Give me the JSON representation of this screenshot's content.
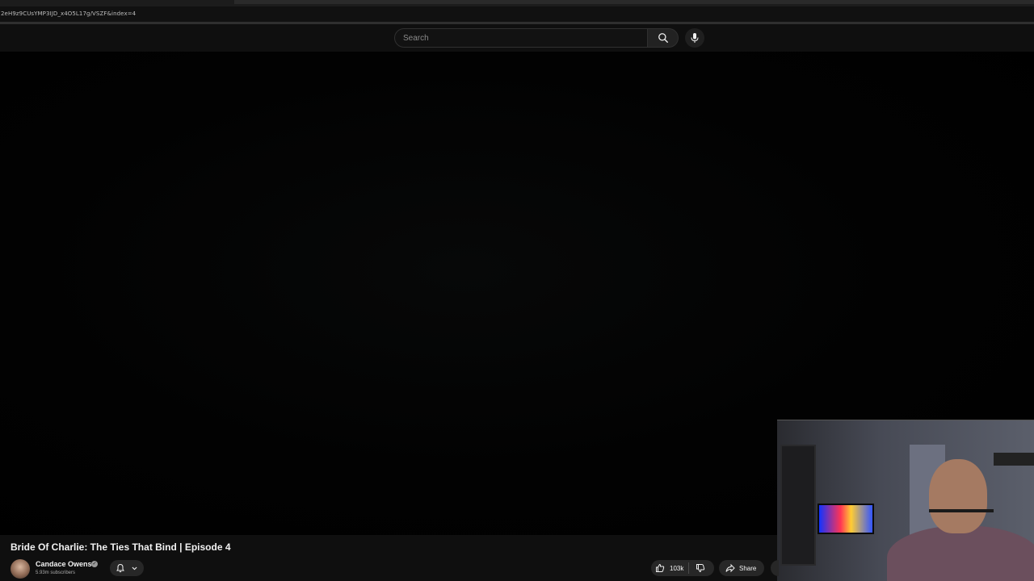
{
  "browser": {
    "url": "2eH9z9CUsYMP3IJD_x4O5L17g/VSZF&index=4"
  },
  "masthead": {
    "search_placeholder": "Search",
    "search_icon": "search-icon",
    "mic_icon": "microphone-icon"
  },
  "video": {
    "title": "Bride Of Charlie: The Ties That Bind | Episode 4",
    "channel": {
      "name": "Candace Owens",
      "verified_icon": "verified-checkmark-icon",
      "subscribers": "5.93m subscribers"
    },
    "actions": {
      "like_count": "103k",
      "share_label": "Share"
    }
  }
}
